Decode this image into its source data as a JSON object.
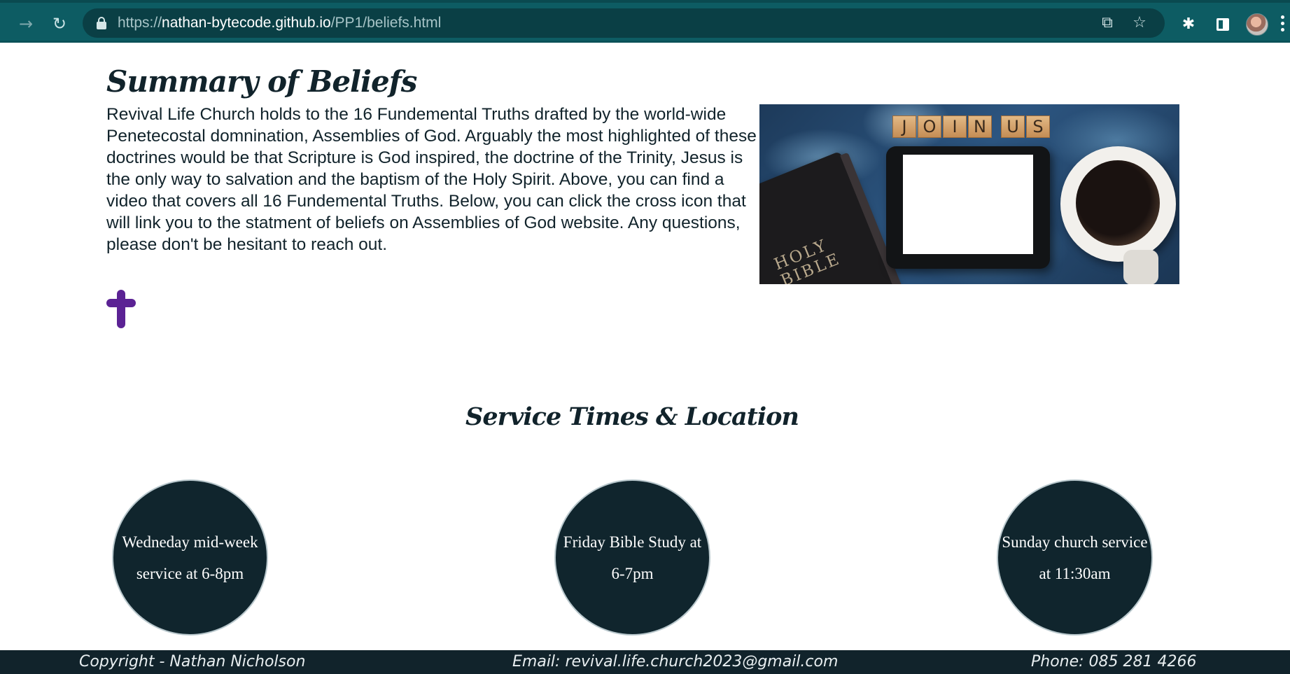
{
  "browser": {
    "url_scheme": "https://",
    "url_host": "nathan-bytecode.github.io",
    "url_path": "/PP1/beliefs.html",
    "icons": {
      "forward": "forward-arrow-icon",
      "reload": "reload-icon",
      "lock": "lock-icon",
      "share": "share-icon",
      "bookmark": "star-icon",
      "extensions": "puzzle-icon",
      "side_panel": "side-panel-icon",
      "profile": "avatar",
      "menu": "kebab-menu-icon"
    }
  },
  "beliefs": {
    "title": "Summary of Beliefs",
    "body": "Revival Life Church holds to the 16 Fundemental Truths drafted by the world-wide Penetecostal domnination, Assemblies of God. Arguably the most highlighted of these doctrines would be that Scripture is God inspired, the doctrine of the Trinity, Jesus is the only way to salvation and the baptism of the Holy Spirit. Above, you can find a video that covers all 16 Fundemental Truths. Below, you can click the cross icon that will link you to the statment of beliefs on Assemblies of God website. Any questions, please don't be hesitant to reach out.",
    "image": {
      "tiles_word1": [
        "J",
        "O",
        "I",
        "N"
      ],
      "tiles_word2": [
        "U",
        "S"
      ],
      "bible_line1": "HOLY",
      "bible_line2": "BIBLE"
    },
    "cross_color": "#5b2294"
  },
  "services": {
    "title": "Service Times & Location",
    "items": [
      {
        "text": "Wedneday mid-week service at 6-8pm"
      },
      {
        "text": "Friday Bible Study at 6-7pm"
      },
      {
        "text": "Sunday church service at 11:30am"
      }
    ]
  },
  "footer": {
    "copyright": "Copyright - Nathan Nicholson",
    "email": "Email: revival.life.church2023@gmail.com",
    "phone": "Phone: 085 281 4266"
  },
  "colors": {
    "browser_bar": "#0d5c63",
    "text_dark": "#11232b",
    "circle_fill": "#10252d",
    "footer_bg": "#11232b"
  }
}
